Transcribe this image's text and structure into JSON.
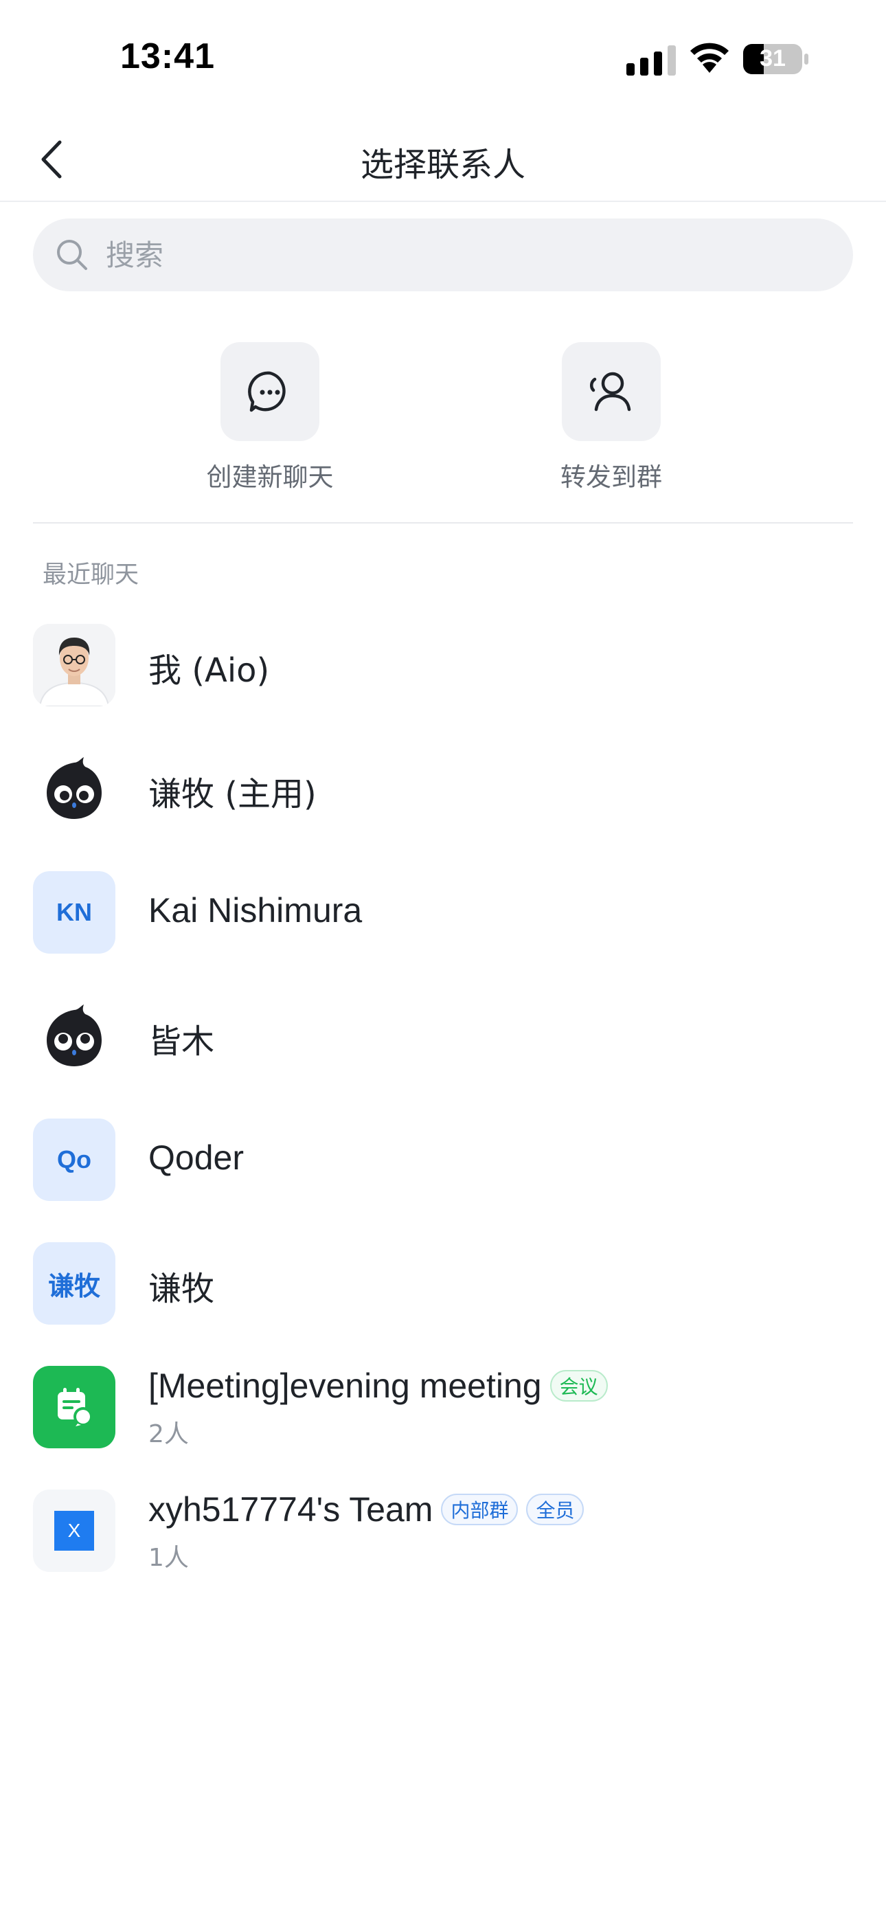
{
  "status_bar": {
    "time": "13:41",
    "battery_level": "31",
    "icons": [
      "signal-icon",
      "wifi-icon",
      "battery-icon"
    ]
  },
  "nav": {
    "title": "选择联系人",
    "back_icon": "chevron-left-icon"
  },
  "search": {
    "placeholder": "搜索",
    "value": ""
  },
  "actions": [
    {
      "label": "创建新聊天",
      "icon": "chat-bubble-icon"
    },
    {
      "label": "转发到群",
      "icon": "group-user-icon"
    }
  ],
  "recent": {
    "title": "最近聊天",
    "items": [
      {
        "name": "我 (Aio)",
        "avatar": "photo"
      },
      {
        "name": "谦牧 (主用)",
        "avatar": "mascot"
      },
      {
        "name": "Kai Nishimura",
        "avatar_text": "KN"
      },
      {
        "name": "皆木",
        "avatar": "mascot"
      },
      {
        "name": "Qoder",
        "avatar_text": "Qo"
      },
      {
        "name": "谦牧",
        "avatar_text": "谦牧"
      },
      {
        "name": "[Meeting]evening meeting",
        "subtitle": "2人",
        "tags": [
          "会议"
        ],
        "avatar": "meeting-calendar-icon"
      },
      {
        "name": "xyh517774's Team",
        "subtitle": "1人",
        "tags": [
          "内部群",
          "全员"
        ],
        "avatar_text": "X"
      }
    ]
  },
  "colors": {
    "accent_blue": "#1f6ed8",
    "meeting_green": "#1db954",
    "tile_bg": "#f0f1f4",
    "secondary_text": "#8f959e"
  }
}
